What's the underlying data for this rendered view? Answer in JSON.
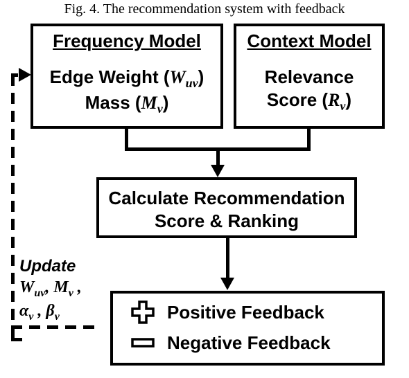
{
  "caption": "Fig. 4.   The recommendation system with feedback",
  "freq": {
    "title": "Frequency Model",
    "line1_a": "Edge Weight (",
    "line1_w": "W",
    "line1_sub": "uv",
    "line1_b": ")",
    "line2_a": "Mass (",
    "line2_m": "M",
    "line2_sub": "v",
    "line2_b": ")"
  },
  "ctx": {
    "title": "Context Model",
    "line1": "Relevance",
    "line2_a": "Score (",
    "line2_r": "R",
    "line2_sub": "v",
    "line2_b": ")"
  },
  "calc": {
    "line1": "Calculate Recommendation",
    "line2": "Score & Ranking"
  },
  "fb": {
    "pos": "Positive Feedback",
    "neg": "Negative Feedback"
  },
  "update": {
    "l1": "Update",
    "w": "W",
    "w_sub": "uv",
    "m": "M",
    "m_sub": "v",
    "a": "α",
    "a_sub": "v",
    "b": "β",
    "b_sub": "v"
  },
  "chart_data": {
    "type": "diagram",
    "nodes": [
      {
        "id": "freq",
        "label": "Frequency Model",
        "body": [
          "Edge Weight (W_uv)",
          "Mass (M_v)"
        ]
      },
      {
        "id": "ctx",
        "label": "Context Model",
        "body": [
          "Relevance",
          "Score (R_v)"
        ]
      },
      {
        "id": "calc",
        "label": "Calculate Recommendation Score & Ranking"
      },
      {
        "id": "fb",
        "label": "Feedback",
        "body": [
          "Positive Feedback",
          "Negative Feedback"
        ]
      }
    ],
    "edges": [
      {
        "from": "freq",
        "to": "calc",
        "style": "solid"
      },
      {
        "from": "ctx",
        "to": "calc",
        "style": "solid"
      },
      {
        "from": "calc",
        "to": "fb",
        "style": "solid"
      },
      {
        "from": "fb",
        "to": "freq",
        "style": "dashed",
        "label": "Update W_uv, M_v, α_v, β_v"
      }
    ]
  }
}
